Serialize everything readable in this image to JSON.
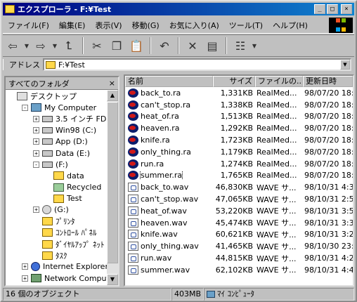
{
  "window": {
    "title": "エクスプローラ - F:¥Test",
    "controls": {
      "minimize": "_",
      "maximize": "□",
      "close": "×"
    }
  },
  "menubar": {
    "items": [
      "ファイル(F)",
      "編集(E)",
      "表示(V)",
      "移動(G)",
      "お気に入り(A)",
      "ツール(T)",
      "ヘルプ(H)"
    ]
  },
  "toolbar": {
    "buttons": [
      "back-arrow-icon",
      "forward-arrow-icon",
      "up-folder-icon",
      "cut-icon",
      "copy-icon",
      "paste-icon",
      "undo-icon",
      "delete-icon",
      "properties-icon",
      "views-icon"
    ]
  },
  "address": {
    "label": "アドレス",
    "value": "F:¥Test"
  },
  "folders_pane": {
    "title": "すべてのフォルダ",
    "close": "×",
    "tree": [
      {
        "label": "デスクトップ",
        "icon": "desktop-icon",
        "depth": 0,
        "expander": ""
      },
      {
        "label": "My Computer",
        "icon": "computer-icon",
        "depth": 1,
        "expander": "-"
      },
      {
        "label": "3.5 インチ FD (A:)",
        "icon": "floppy-icon",
        "depth": 2,
        "expander": "+"
      },
      {
        "label": "Win98 (C:)",
        "icon": "drive-icon",
        "depth": 2,
        "expander": "+"
      },
      {
        "label": "App (D:)",
        "icon": "drive-icon",
        "depth": 2,
        "expander": "+"
      },
      {
        "label": "Data (E:)",
        "icon": "drive-icon",
        "depth": 2,
        "expander": "+"
      },
      {
        "label": "(F:)",
        "icon": "drive-icon",
        "depth": 2,
        "expander": "-"
      },
      {
        "label": "data",
        "icon": "folder-icon",
        "depth": 3,
        "expander": ""
      },
      {
        "label": "Recycled",
        "icon": "recycle-icon",
        "depth": 3,
        "expander": ""
      },
      {
        "label": "Test",
        "icon": "folder-open-icon",
        "depth": 3,
        "expander": ""
      },
      {
        "label": "(G:)",
        "icon": "cd-drive-icon",
        "depth": 2,
        "expander": "+"
      },
      {
        "label": "ﾌﾟﾘﾝﾀ",
        "icon": "printer-folder-icon",
        "depth": 2,
        "expander": ""
      },
      {
        "label": "ｺﾝﾄﾛｰﾙ ﾊﾟﾈﾙ",
        "icon": "control-panel-icon",
        "depth": 2,
        "expander": ""
      },
      {
        "label": "ﾀﾞｲﾔﾙｱｯﾌﾟ ﾈｯﾄ",
        "icon": "dialup-icon",
        "depth": 2,
        "expander": ""
      },
      {
        "label": "ﾀｽｸ",
        "icon": "task-folder-icon",
        "depth": 2,
        "expander": ""
      },
      {
        "label": "Internet Explorer",
        "icon": "ie-icon",
        "depth": 1,
        "expander": "+"
      },
      {
        "label": "Network Computer",
        "icon": "network-icon",
        "depth": 1,
        "expander": "+"
      }
    ]
  },
  "file_list": {
    "columns": {
      "name": "名前",
      "size": "サイズ",
      "type": "ファイルの...",
      "modified": "更新日時"
    },
    "rows": [
      {
        "name": "back_to.ra",
        "size": "1,331KB",
        "type": "RealMed...",
        "modified": "98/07/20 18:00",
        "icon": "realmedia-icon"
      },
      {
        "name": "can't_stop.ra",
        "size": "1,338KB",
        "type": "RealMed...",
        "modified": "98/07/20 18:00",
        "icon": "realmedia-icon"
      },
      {
        "name": "heat_of.ra",
        "size": "1,513KB",
        "type": "RealMed...",
        "modified": "98/07/20 18:00",
        "icon": "realmedia-icon"
      },
      {
        "name": "heaven.ra",
        "size": "1,292KB",
        "type": "RealMed...",
        "modified": "98/07/20 18:00",
        "icon": "realmedia-icon"
      },
      {
        "name": "knife.ra",
        "size": "1,723KB",
        "type": "RealMed...",
        "modified": "98/07/20 18:00",
        "icon": "realmedia-icon"
      },
      {
        "name": "only_thing.ra",
        "size": "1,179KB",
        "type": "RealMed...",
        "modified": "98/07/20 18:00",
        "icon": "realmedia-icon"
      },
      {
        "name": "run.ra",
        "size": "1,274KB",
        "type": "RealMed...",
        "modified": "98/07/20 18:00",
        "icon": "realmedia-icon"
      },
      {
        "name": "summer.ra",
        "size": "1,765KB",
        "type": "RealMed...",
        "modified": "98/07/20 18:00",
        "icon": "realmedia-icon"
      },
      {
        "name": "back_to.wav",
        "size": "46,830KB",
        "type": "WAVE サ...",
        "modified": "98/10/31 4:32",
        "icon": "wave-icon"
      },
      {
        "name": "can't_stop.wav",
        "size": "47,065KB",
        "type": "WAVE サ...",
        "modified": "98/10/31 2:56",
        "icon": "wave-icon"
      },
      {
        "name": "heat_of.wav",
        "size": "53,220KB",
        "type": "WAVE サ...",
        "modified": "98/10/31 3:58",
        "icon": "wave-icon"
      },
      {
        "name": "heaven.wav",
        "size": "45,474KB",
        "type": "WAVE サ...",
        "modified": "98/10/31 3:35",
        "icon": "wave-icon"
      },
      {
        "name": "knife.wav",
        "size": "60,621KB",
        "type": "WAVE サ...",
        "modified": "98/10/31 3:21",
        "icon": "wave-icon"
      },
      {
        "name": "only_thing.wav",
        "size": "41,465KB",
        "type": "WAVE サ...",
        "modified": "98/10/30 23:08",
        "icon": "wave-icon"
      },
      {
        "name": "run.wav",
        "size": "44,815KB",
        "type": "WAVE サ...",
        "modified": "98/10/31 4:24",
        "icon": "wave-icon"
      },
      {
        "name": "summer.wav",
        "size": "62,102KB",
        "type": "WAVE サ...",
        "modified": "98/10/31 4:44",
        "icon": "wave-icon"
      }
    ]
  },
  "statusbar": {
    "objects": "16 個のオブジェクト",
    "size": "403MB",
    "location": "ﾏｲ ｺﾝﾋﾟｭｰﾀ"
  },
  "colors": {
    "titlebar_start": "#000080",
    "titlebar_end": "#1084d0",
    "face": "#c0c0c0"
  }
}
